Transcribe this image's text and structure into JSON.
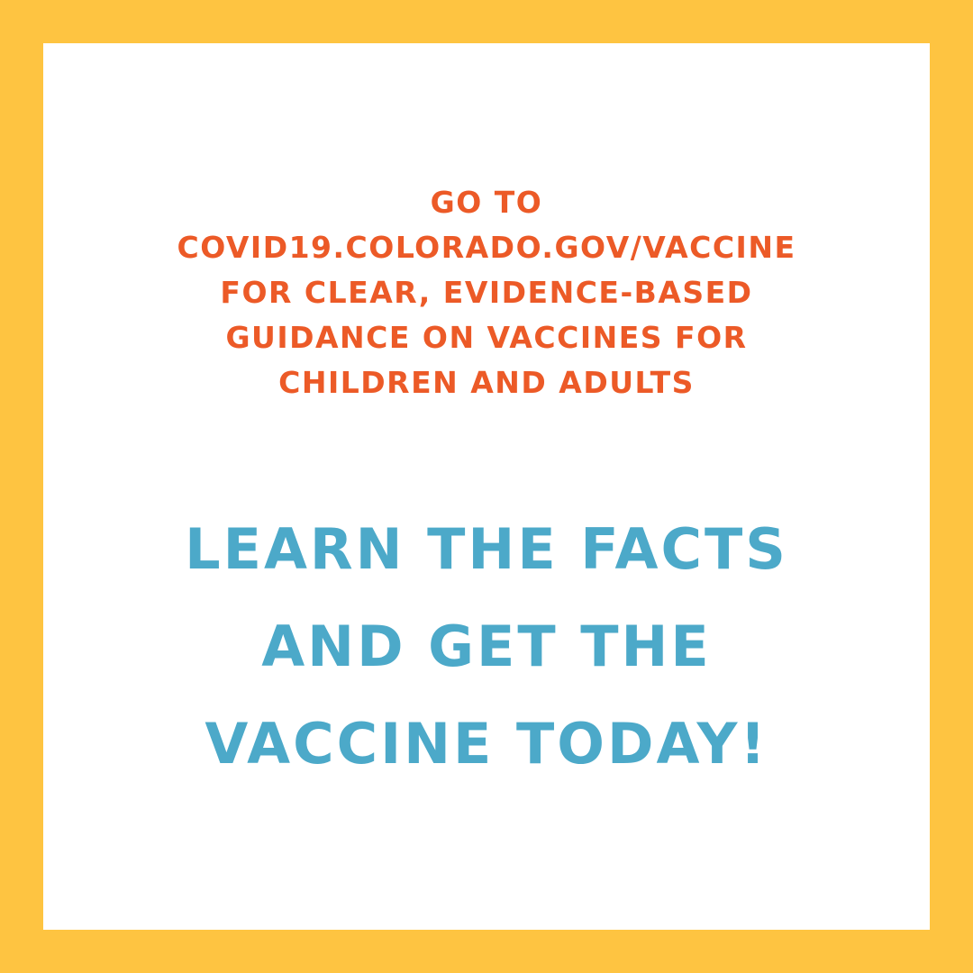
{
  "colors": {
    "border": "#FEC441",
    "panel": "#FFFFFF",
    "info_text": "#EC5A27",
    "headline_text": "#4CA9C9"
  },
  "info": {
    "lines": [
      "GO TO",
      "COVID19.COLORADO.GOV/VACCINE",
      "FOR CLEAR, EVIDENCE-BASED",
      "GUIDANCE ON VACCINES FOR",
      "CHILDREN AND ADULTS"
    ]
  },
  "headline": {
    "lines": [
      "LEARN THE FACTS",
      "AND GET THE",
      "VACCINE TODAY!"
    ]
  }
}
